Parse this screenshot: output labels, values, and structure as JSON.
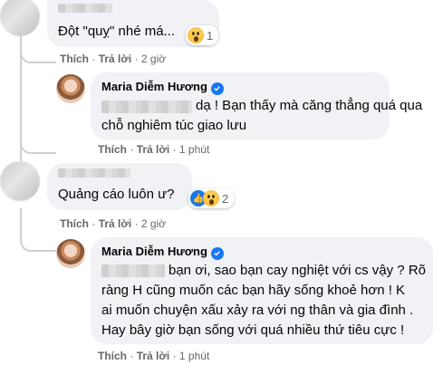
{
  "comments": [
    {
      "text": "Đột \"quỵ\" nhé má...",
      "reaction_count": "1",
      "actions": {
        "like": "Thích",
        "reply": "Trả lời",
        "time": "2 giờ"
      }
    },
    {
      "author": "Maria Diễm Hương",
      "text_line1": "dạ ! Bạn thấy mà căng thẳng quá qua",
      "text_line2": "chỗ nghiêm túc giao lưu",
      "actions": {
        "like": "Thích",
        "reply": "Trả lời",
        "time": "1 phút"
      }
    },
    {
      "text": "Quảng cáo luôn ư?",
      "reaction_count": "2",
      "actions": {
        "like": "Thích",
        "reply": "Trả lời",
        "time": "2 giờ"
      }
    },
    {
      "author": "Maria Diễm Hương",
      "text_line1": "bạn ơi, sao bạn cay nghiệt với cs vậy ? Rõ",
      "text_line2": "ràng H cũng muốn các bạn hãy sống khoẻ hơn ! K",
      "text_line3": "ai muốn chuyện xấu xảy ra với ng thân và gia đình .",
      "text_line4": "Hay bây giờ bạn sống với quá nhiều thứ tiêu cực !",
      "actions": {
        "like": "Thích",
        "reply": "Trả lời",
        "time": "1 phút"
      }
    }
  ],
  "colors": {
    "bubble": "#f0f2f5",
    "meta": "#65676b",
    "verified": "#1877f2"
  }
}
